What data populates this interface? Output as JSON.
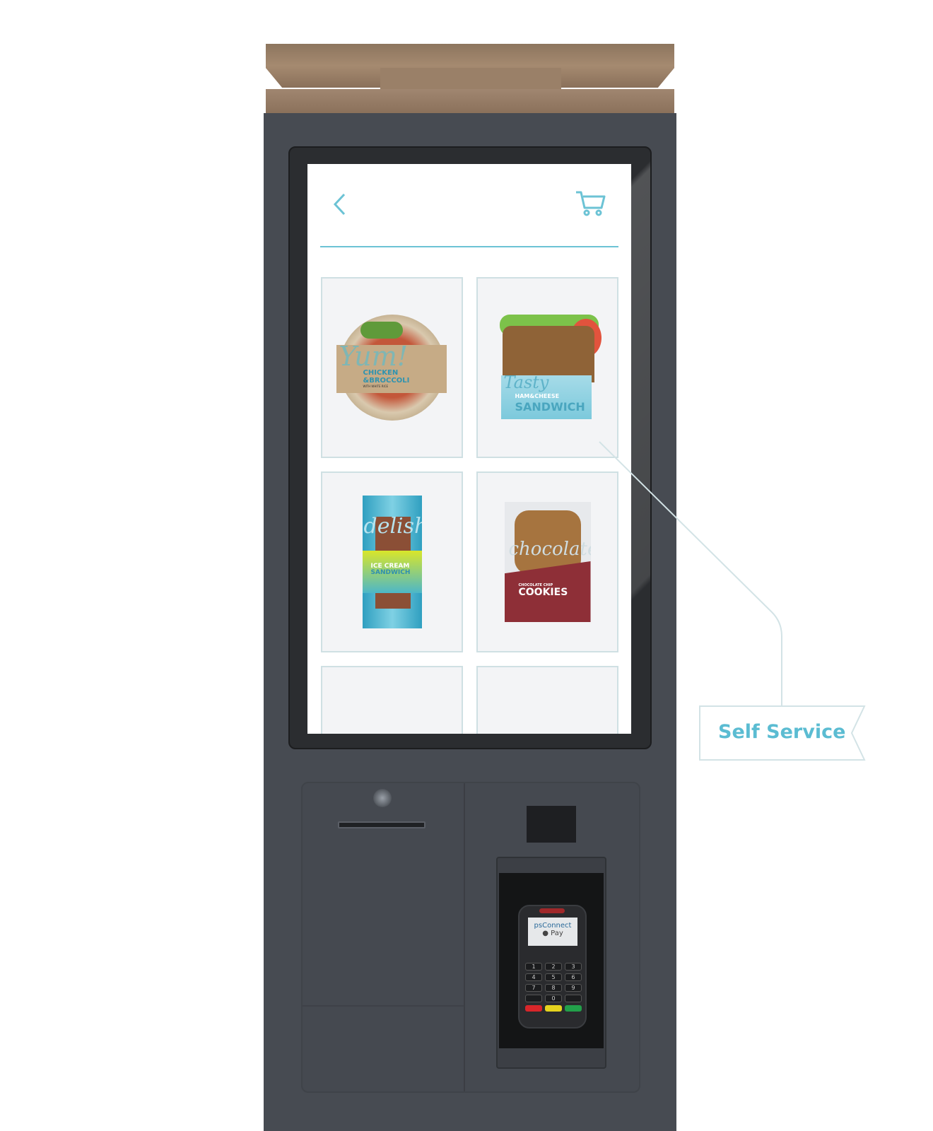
{
  "screen": {
    "back_icon": "chevron-left-icon",
    "cart_icon": "cart-icon",
    "accent": "#6cc3d5",
    "products": [
      {
        "brand": "Yum!",
        "line1": "CHICKEN",
        "line2": "&BROCCOLI",
        "line3": "WITH WHITE RICE"
      },
      {
        "brand": "Tasty",
        "line1": "HAM&CHEESE",
        "line2": "SANDWICH"
      },
      {
        "brand": "delish",
        "line1": "ICE CREAM",
        "line2": "SANDWICH"
      },
      {
        "brand": "chocolate",
        "line1": "CHOCOLATE CHIP",
        "line2": "COOKIES"
      }
    ]
  },
  "terminal": {
    "screen_line1": "psConnect",
    "screen_line2": "Pay",
    "keys": [
      "1",
      "2",
      "3",
      "4",
      "5",
      "6",
      "7",
      "8",
      "9",
      "",
      "0",
      ""
    ]
  },
  "callout": {
    "label": "Self Service",
    "color": "#5bbcd2"
  }
}
